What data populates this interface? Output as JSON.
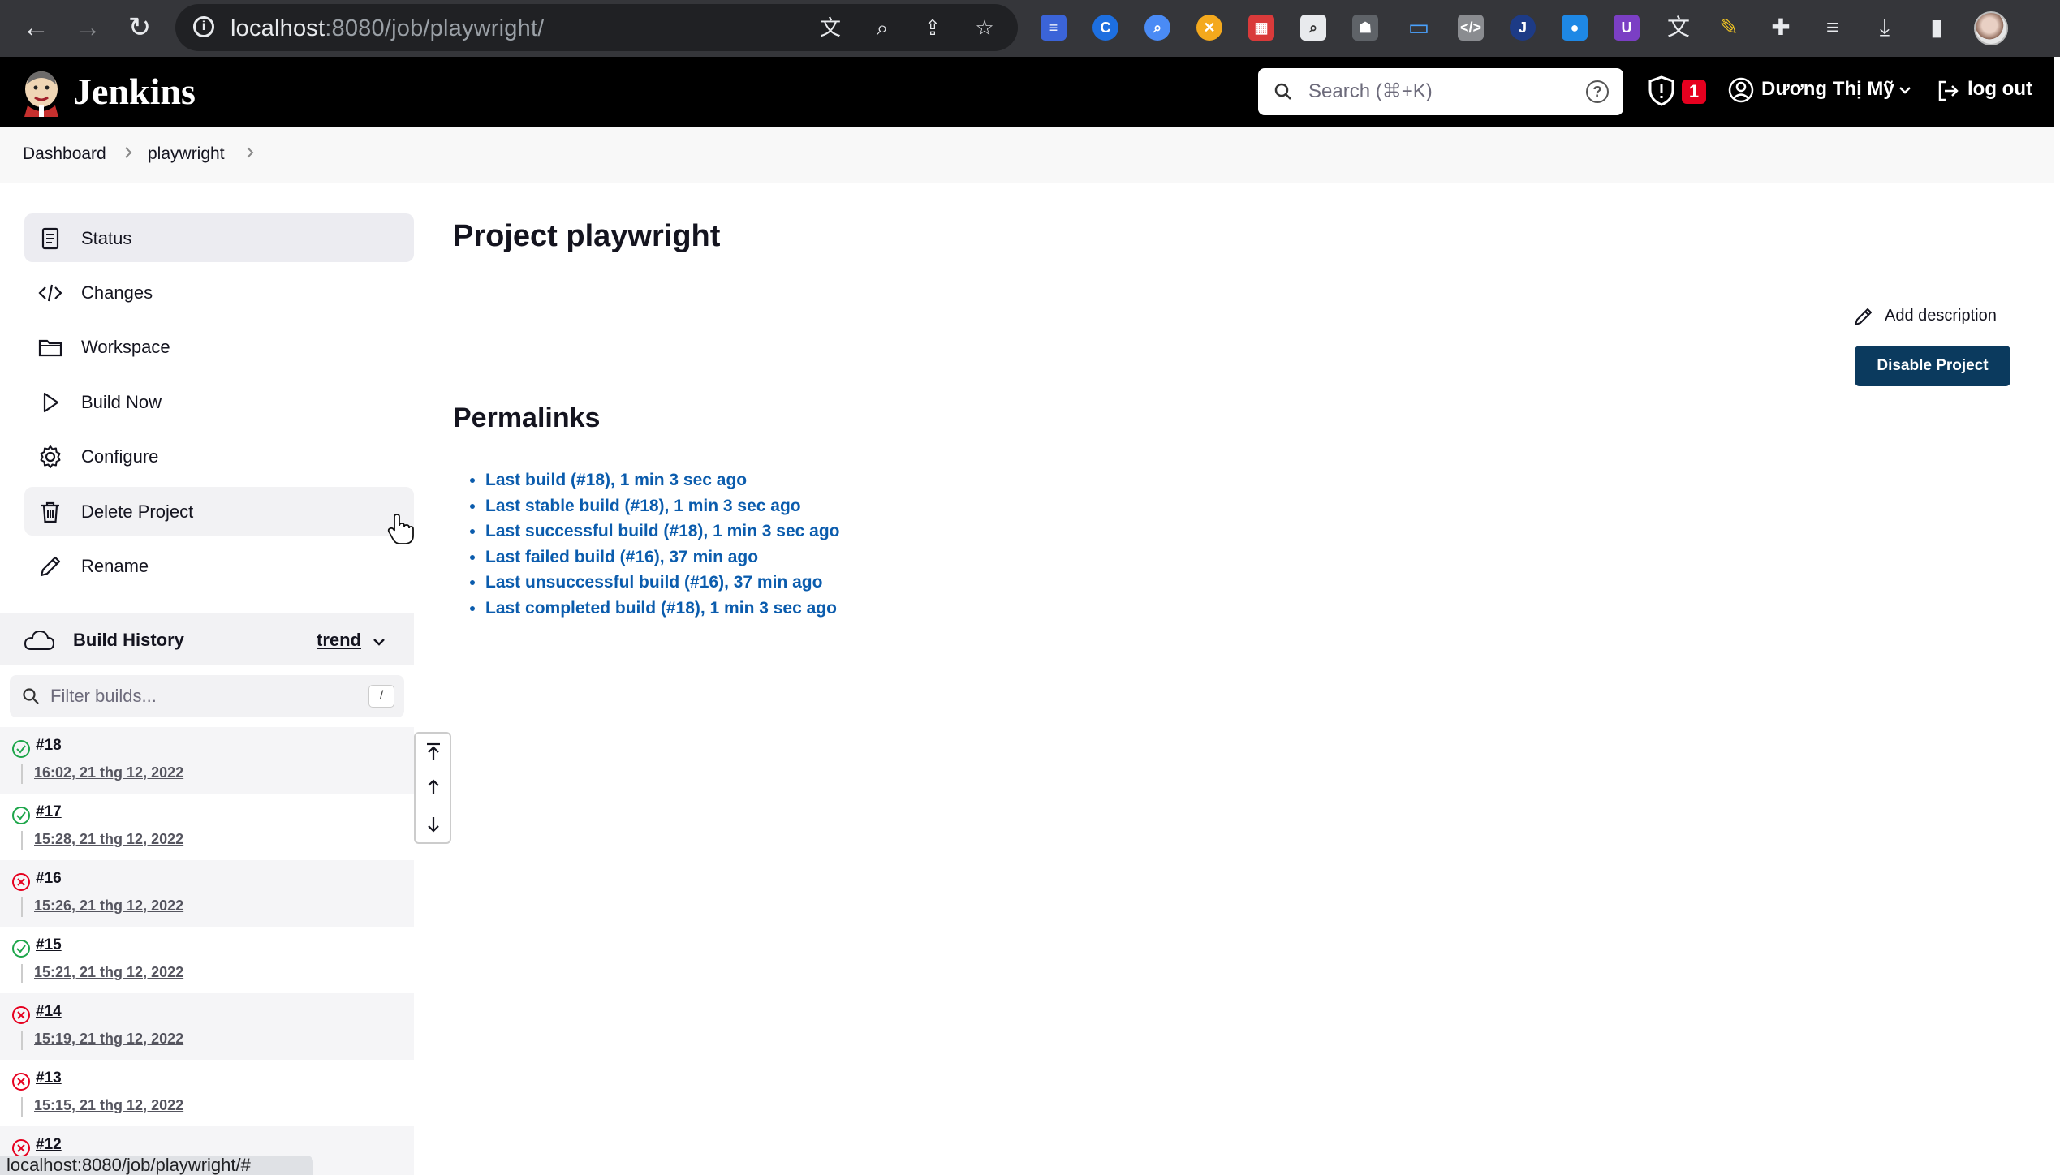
{
  "browser": {
    "url_host": "localhost",
    "url_rest": ":8080/job/playwright/"
  },
  "header": {
    "brand": "Jenkins",
    "search_placeholder": "Search (⌘+K)",
    "security_count": "1",
    "user_name": "Dương Thị Mỹ",
    "logout_label": "log out"
  },
  "breadcrumb": [
    "Dashboard",
    "playwright"
  ],
  "sidebar": {
    "tasks": [
      {
        "label": "Status",
        "icon": "document-icon"
      },
      {
        "label": "Changes",
        "icon": "code-icon"
      },
      {
        "label": "Workspace",
        "icon": "folder-icon"
      },
      {
        "label": "Build Now",
        "icon": "play-icon"
      },
      {
        "label": "Configure",
        "icon": "gear-icon"
      },
      {
        "label": "Delete Project",
        "icon": "trash-icon"
      },
      {
        "label": "Rename",
        "icon": "pencil-icon"
      }
    ],
    "build_history": {
      "title": "Build History",
      "trend": "trend",
      "filter_placeholder": "Filter builds...",
      "filter_shortcut": "/",
      "builds": [
        {
          "number": "#18",
          "time": "16:02, 21 thg 12, 2022",
          "status": "success"
        },
        {
          "number": "#17",
          "time": "15:28, 21 thg 12, 2022",
          "status": "success"
        },
        {
          "number": "#16",
          "time": "15:26, 21 thg 12, 2022",
          "status": "failed"
        },
        {
          "number": "#15",
          "time": "15:21, 21 thg 12, 2022",
          "status": "success"
        },
        {
          "number": "#14",
          "time": "15:19, 21 thg 12, 2022",
          "status": "failed"
        },
        {
          "number": "#13",
          "time": "15:15, 21 thg 12, 2022",
          "status": "failed"
        },
        {
          "number": "#12",
          "time": "",
          "status": "failed"
        }
      ]
    }
  },
  "main": {
    "title": "Project playwright",
    "add_description": "Add description",
    "disable_button": "Disable Project",
    "permalinks_heading": "Permalinks",
    "permalinks": [
      "Last build (#18), 1 min 3 sec ago",
      "Last stable build (#18), 1 min 3 sec ago",
      "Last successful build (#18), 1 min 3 sec ago",
      "Last failed build (#16), 37 min ago",
      "Last unsuccessful build (#16), 37 min ago",
      "Last completed build (#18), 1 min 3 sec ago"
    ]
  },
  "status_bar": {
    "url": "localhost:8080/job/playwright/#"
  },
  "colors": {
    "success": "#1ea64b",
    "failed": "#e6001f",
    "link": "#0b5cad",
    "primary_button": "#0b3a5e"
  }
}
